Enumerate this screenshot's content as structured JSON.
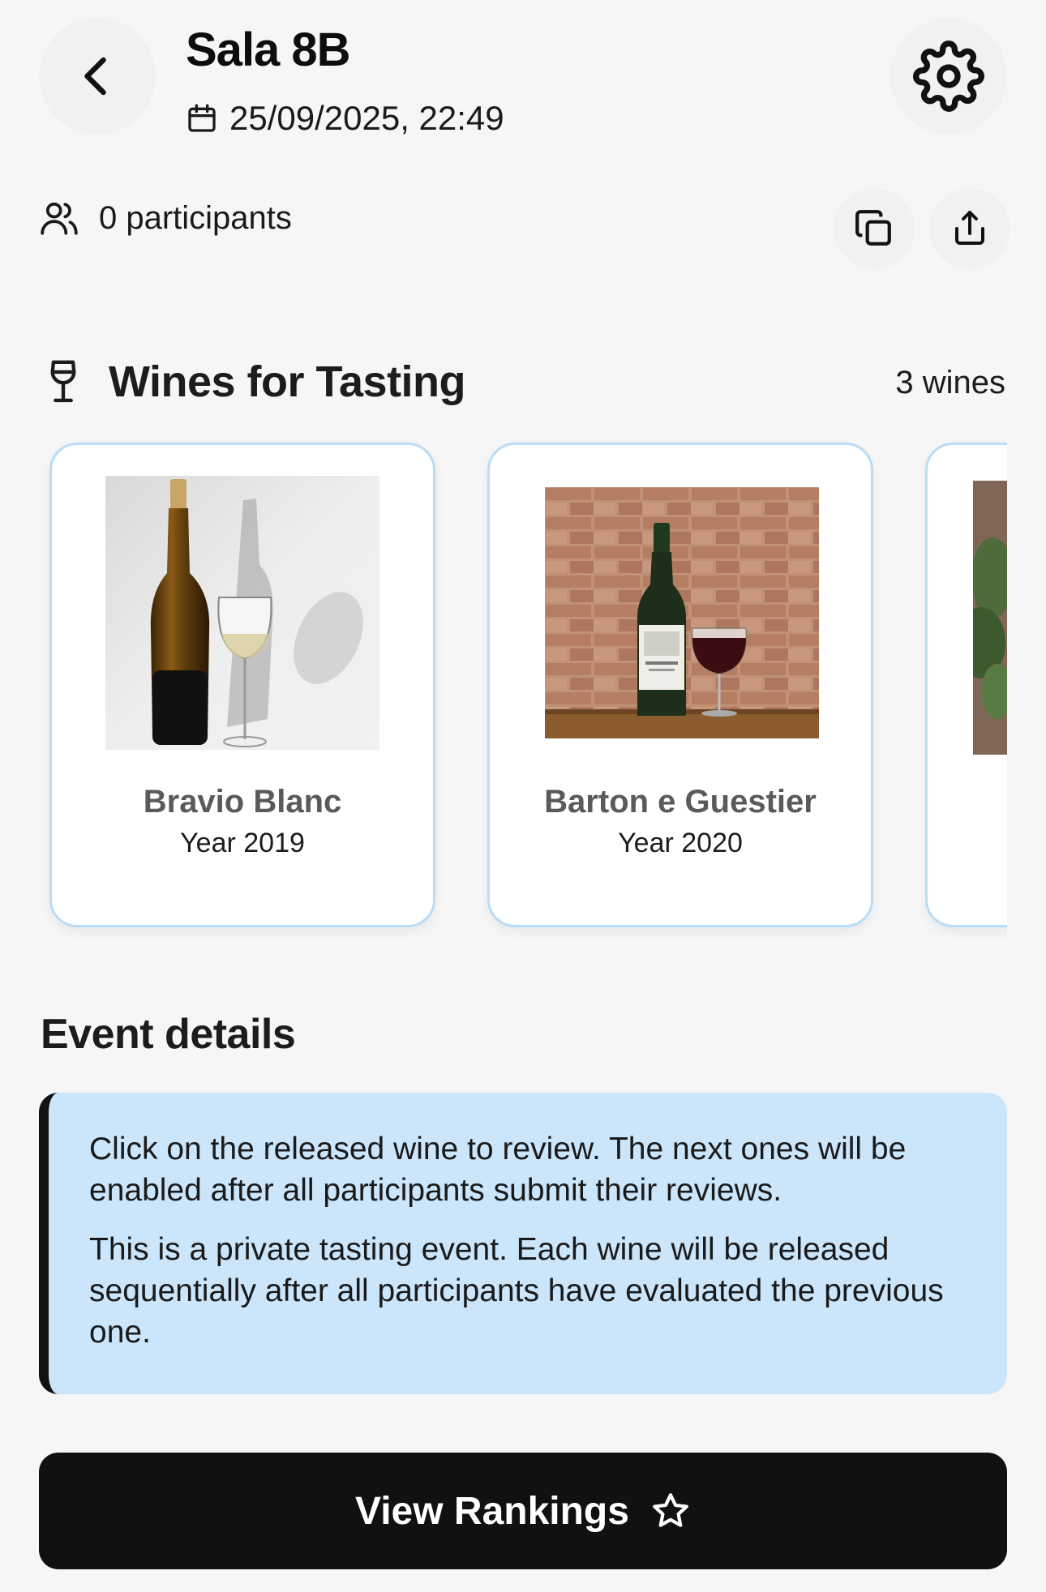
{
  "header": {
    "title": "Sala 8B",
    "datetime": "25/09/2025, 22:49",
    "icons": {
      "back": "chevron-left-icon",
      "settings": "gear-icon",
      "calendar": "calendar-icon"
    }
  },
  "participants": {
    "label": "0 participants",
    "icons": {
      "people": "users-icon",
      "copy": "copy-icon",
      "share": "share-icon"
    }
  },
  "wines": {
    "title": "Wines for Tasting",
    "count_label": "3 wines",
    "icon": "wine-glass-icon",
    "items": [
      {
        "name": "Bravio Blanc",
        "year": "Year 2019",
        "image": "wine-bottle-glass-photo"
      },
      {
        "name": "Barton e Guestier",
        "year": "Year 2020",
        "image": "wine-bottle-brick-photo"
      },
      {
        "name": "",
        "year": "",
        "image": "wine-plant-photo"
      }
    ]
  },
  "event": {
    "title": "Event details",
    "paragraphs": [
      "Click on the released wine to review. The next ones will be enabled after all participants submit their reviews.",
      "This is a private tasting event. Each wine will be released sequentially after all participants have evaluated the previous one."
    ]
  },
  "actions": {
    "rankings_label": "View Rankings",
    "rankings_icon": "star-icon"
  },
  "colors": {
    "card_border": "#b9dcf7",
    "info_bg": "#cbe5fb",
    "button_bg": "#111111",
    "page_bg": "#f6f6f6"
  }
}
